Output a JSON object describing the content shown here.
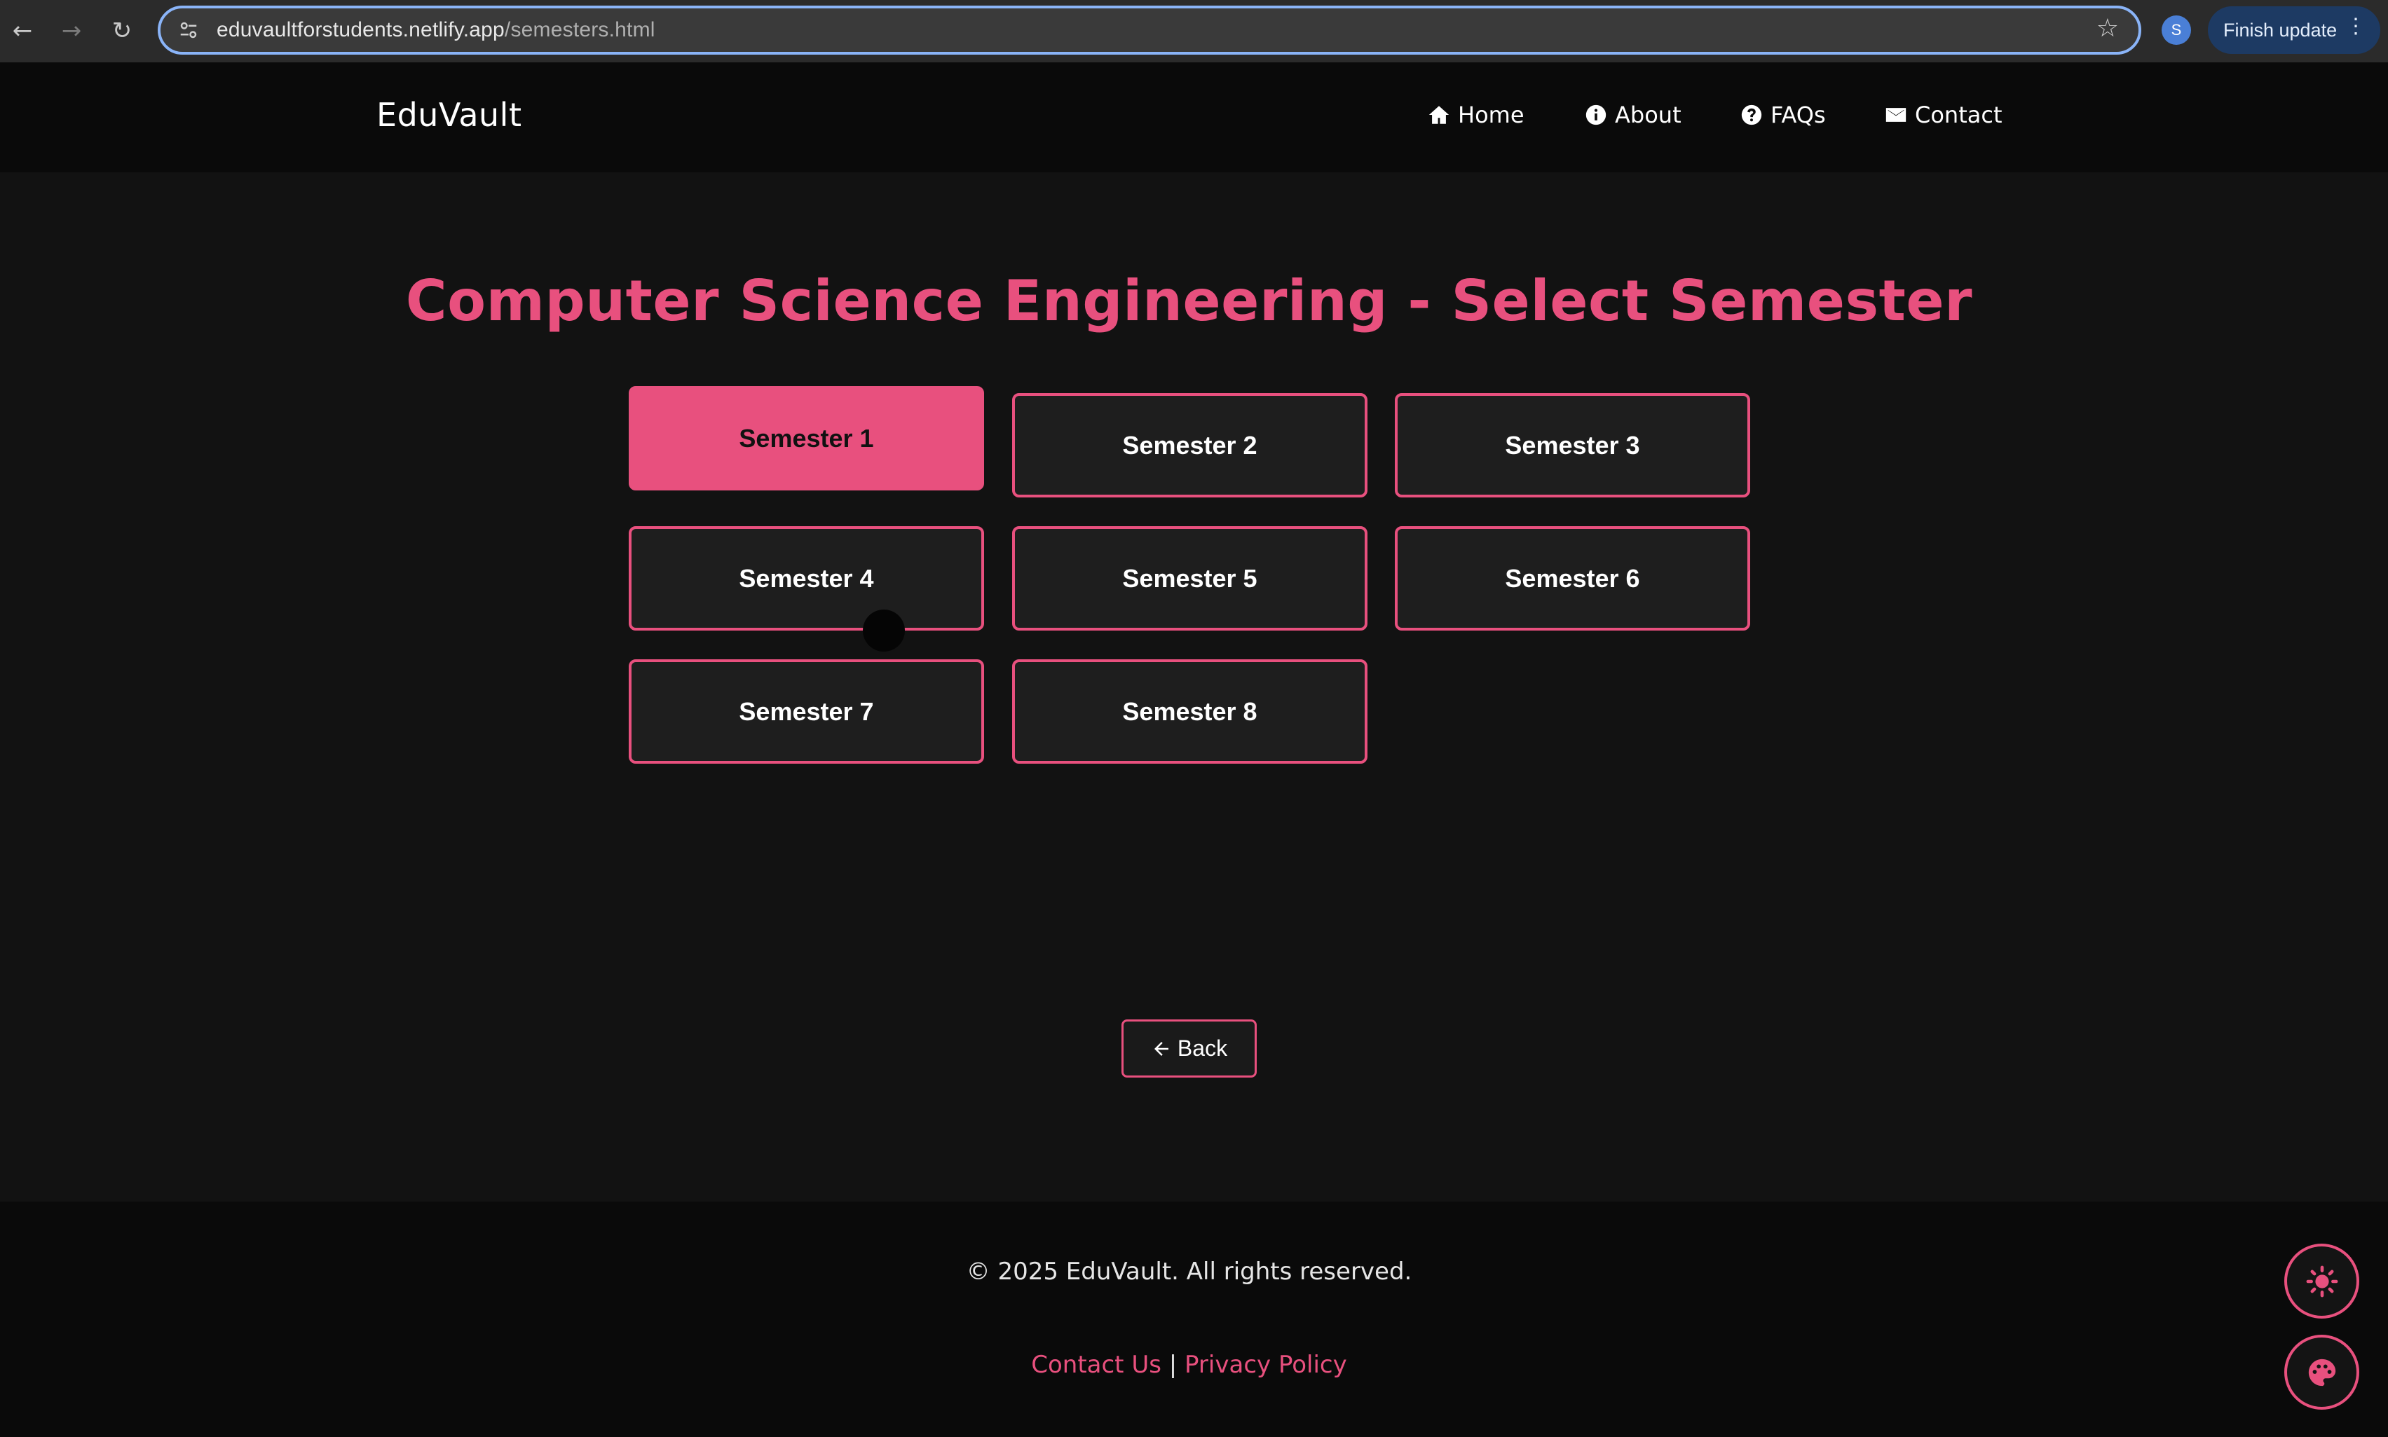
{
  "browser": {
    "url_domain": "eduvaultforstudents.netlify.app",
    "url_path": "/semesters.html",
    "profile_initial": "S",
    "update_label": "Finish update"
  },
  "header": {
    "logo": "EduVault",
    "nav": [
      {
        "label": "Home",
        "icon": "home-icon"
      },
      {
        "label": "About",
        "icon": "info-icon"
      },
      {
        "label": "FAQs",
        "icon": "question-icon"
      },
      {
        "label": "Contact",
        "icon": "envelope-icon"
      }
    ]
  },
  "main": {
    "title": "Computer Science Engineering - Select Semester",
    "semesters": [
      {
        "label": "Semester 1",
        "active": true
      },
      {
        "label": "Semester 2",
        "active": false
      },
      {
        "label": "Semester 3",
        "active": false
      },
      {
        "label": "Semester 4",
        "active": false
      },
      {
        "label": "Semester 5",
        "active": false
      },
      {
        "label": "Semester 6",
        "active": false
      },
      {
        "label": "Semester 7",
        "active": false
      },
      {
        "label": "Semester 8",
        "active": false
      }
    ],
    "back_label": "Back"
  },
  "footer": {
    "copyright": "© 2025 EduVault. All rights reserved.",
    "contact_link": "Contact Us",
    "separator": "|",
    "privacy_link": "Privacy Policy"
  },
  "colors": {
    "accent": "#e8507e",
    "header_bg": "#0a0a0a",
    "page_bg": "#121212",
    "button_bg": "#1e1e1e"
  }
}
